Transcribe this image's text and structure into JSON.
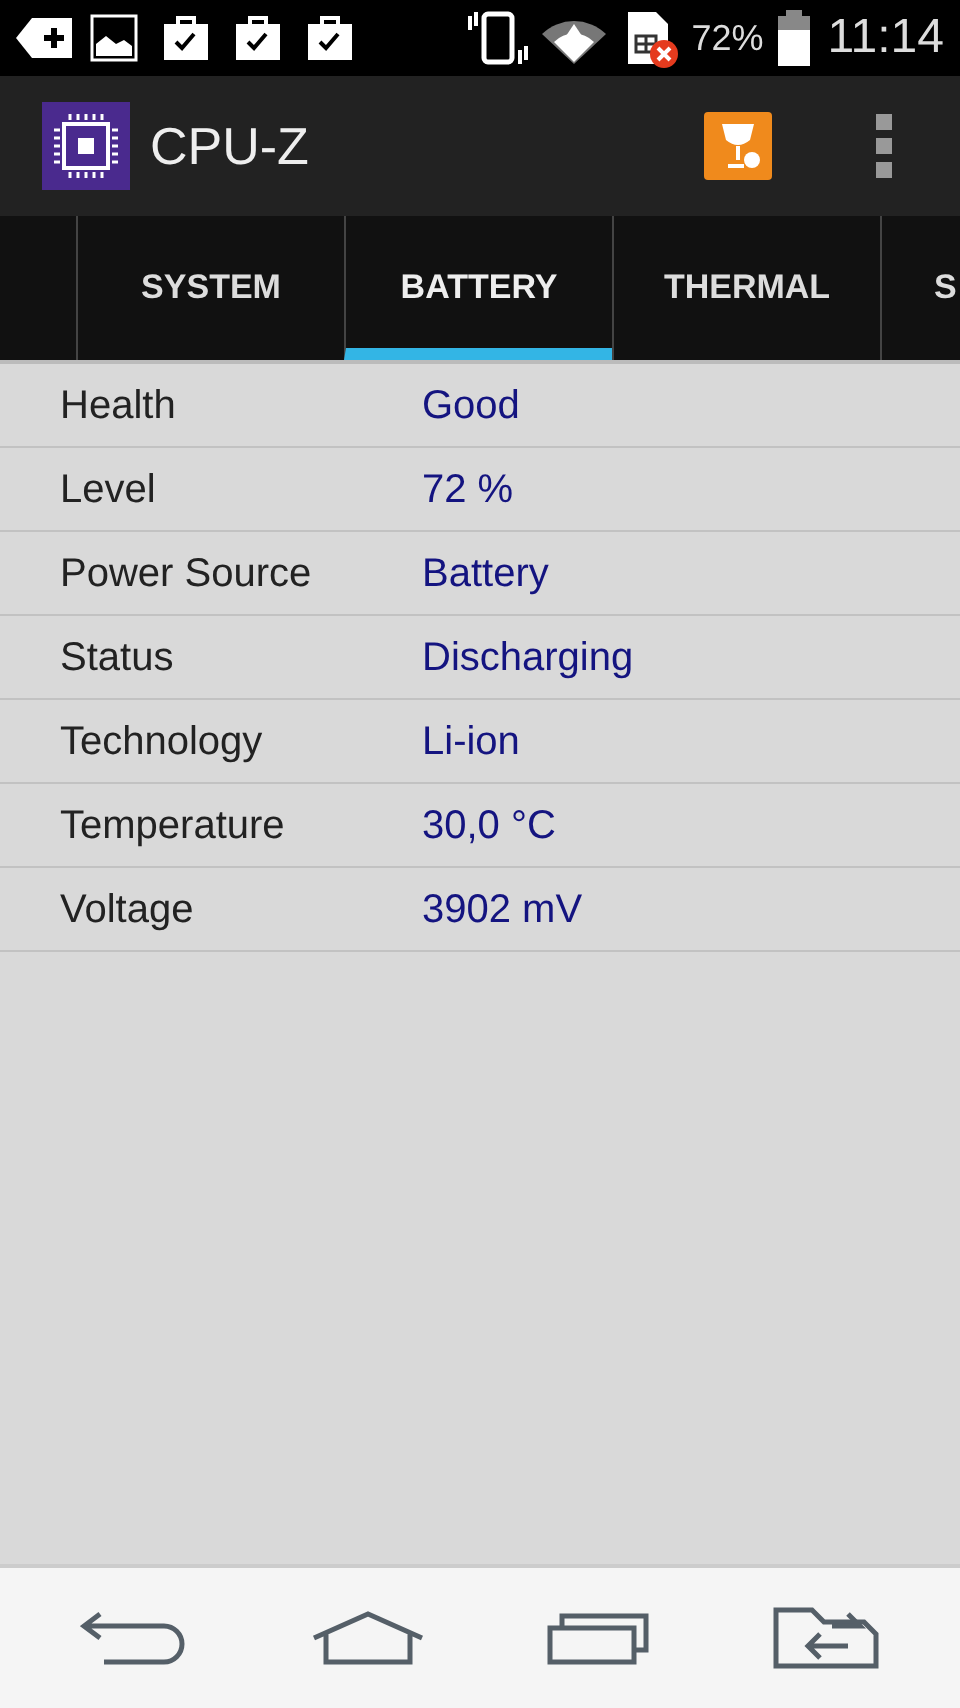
{
  "status_bar": {
    "battery_percent": "72%",
    "time": "11:14"
  },
  "app_bar": {
    "title": "CPU-Z"
  },
  "tabs": [
    {
      "label": "SYSTEM",
      "selected": false
    },
    {
      "label": "BATTERY",
      "selected": true
    },
    {
      "label": "THERMAL",
      "selected": false
    },
    {
      "label": "S",
      "selected": false
    }
  ],
  "rows": [
    {
      "label": "Health",
      "value": "Good"
    },
    {
      "label": "Level",
      "value": "72 %"
    },
    {
      "label": "Power Source",
      "value": "Battery"
    },
    {
      "label": "Status",
      "value": "Discharging"
    },
    {
      "label": "Technology",
      "value": "Li-ion"
    },
    {
      "label": "Temperature",
      "value": "30,0 °C"
    },
    {
      "label": "Voltage",
      "value": "3902 mV"
    }
  ]
}
